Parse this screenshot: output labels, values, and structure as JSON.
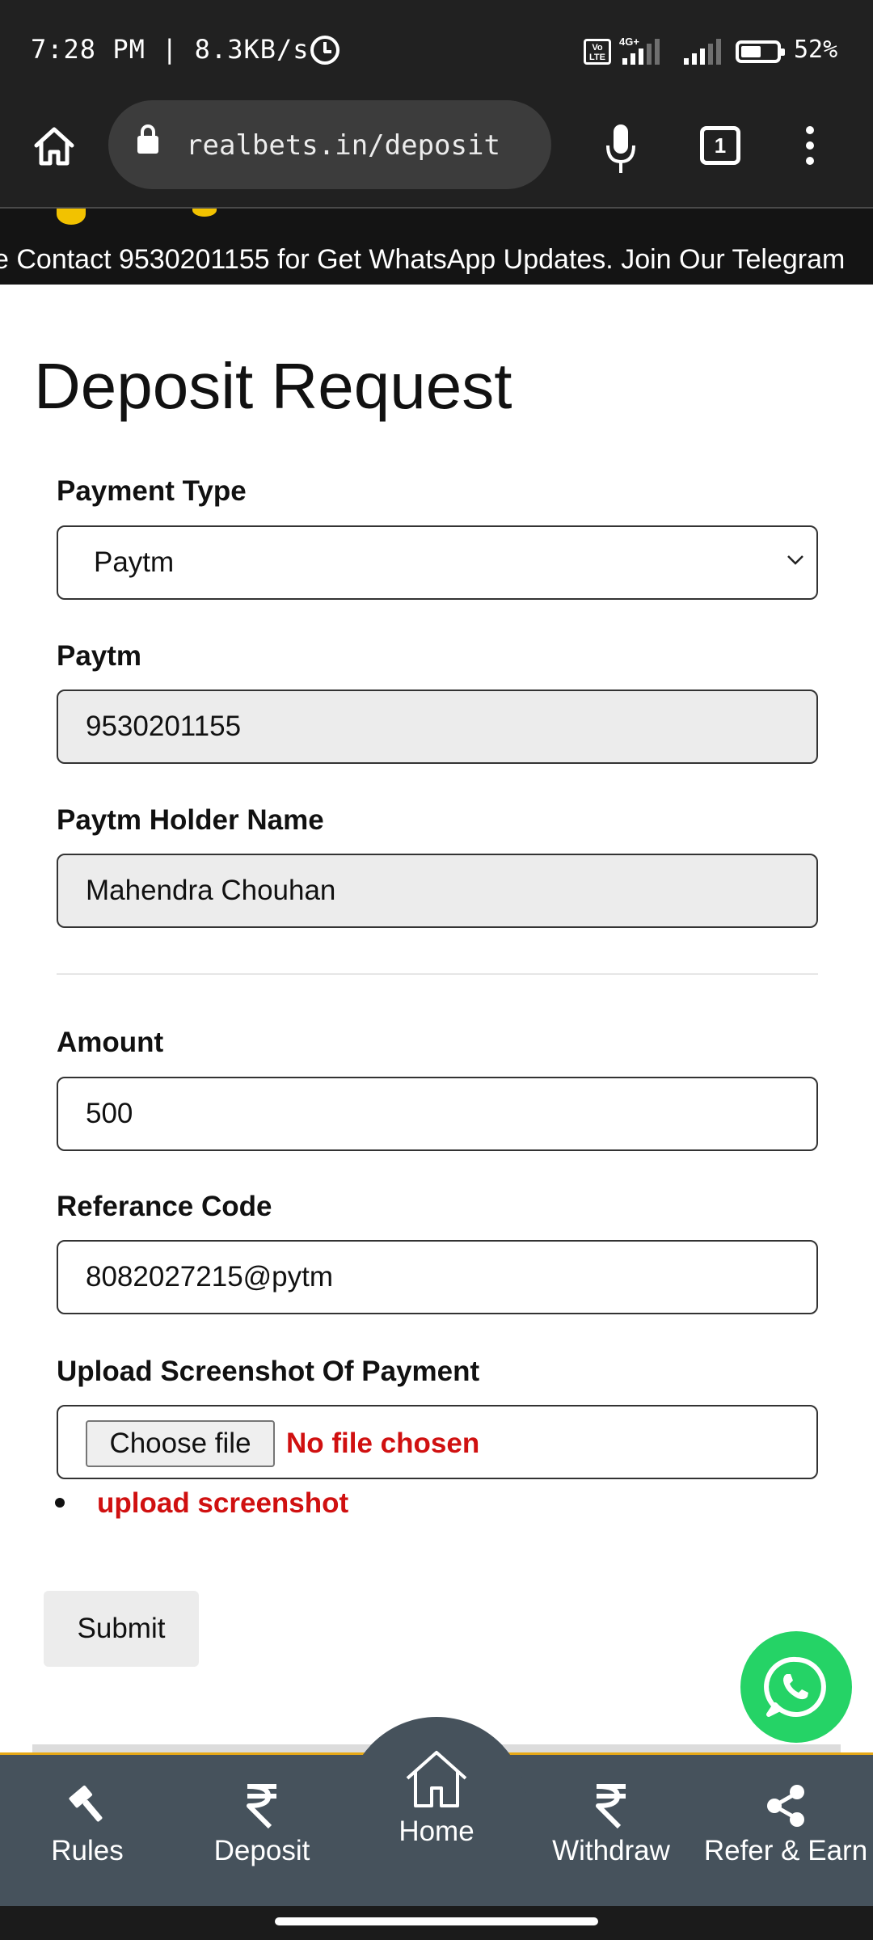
{
  "status_bar": {
    "time": "7:28 PM | 8.3KB/s",
    "network": "4G+",
    "volte": "Vo LTE",
    "battery": "52%"
  },
  "browser": {
    "url": "realbets.in/deposit",
    "tab_count": "1"
  },
  "announcement": "e Contact 9530201155 for Get WhatsApp Updates. Join Our Telegram",
  "form": {
    "title": "Deposit Request",
    "payment_type_label": "Payment Type",
    "payment_type_value": "Paytm",
    "paytm_label": "Paytm",
    "paytm_value": "9530201155",
    "holder_label": "Paytm Holder Name",
    "holder_value": "Mahendra Chouhan",
    "amount_label": "Amount",
    "amount_value": "500",
    "reference_label": "Referance Code",
    "reference_value": "8082027215@pytm",
    "upload_label": "Upload Screenshot Of Payment",
    "choose_file_label": "Choose file",
    "no_file_text": "No file chosen",
    "upload_error": "upload screenshot",
    "submit_label": "Submit"
  },
  "bottom_nav": {
    "items": [
      {
        "label": "Rules",
        "icon": "gavel-icon"
      },
      {
        "label": "Deposit",
        "icon": "rupee-icon"
      },
      {
        "label": "Home",
        "icon": "home-icon"
      },
      {
        "label": "Withdraw",
        "icon": "rupee-icon"
      },
      {
        "label": "Refer & Earn",
        "icon": "share-icon"
      }
    ]
  },
  "colors": {
    "error": "#d01010",
    "nav_background": "#46525c",
    "nav_accent": "#e6a817",
    "whatsapp": "#25d366"
  }
}
